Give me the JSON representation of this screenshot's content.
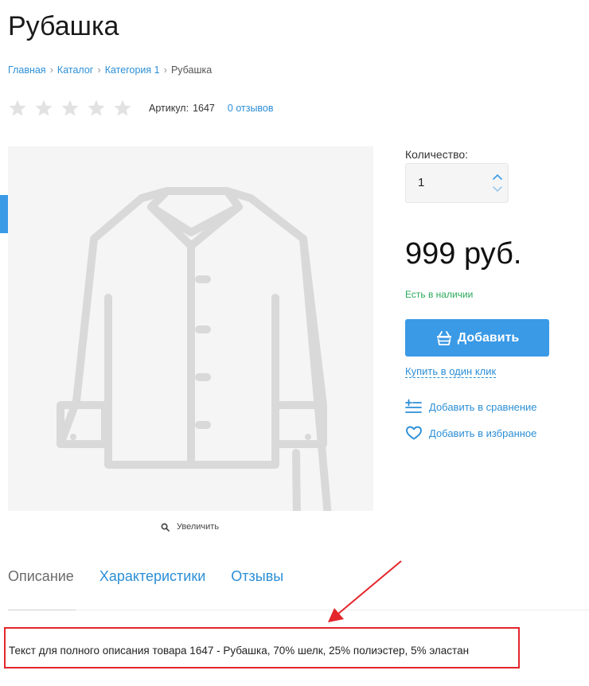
{
  "product": {
    "title": "Рубашка",
    "article_label": "Артикул:",
    "article_value": "1647",
    "reviews_link": "0 отзывов",
    "rating": 0,
    "rating_max": 5
  },
  "breadcrumb": {
    "items": [
      "Главная",
      "Каталог",
      "Категория 1"
    ],
    "current": "Рубашка"
  },
  "image": {
    "zoom_label": "Увеличить"
  },
  "buy": {
    "quantity_label": "Количество:",
    "quantity_value": "1",
    "price": "999 руб.",
    "stock": "Есть в наличии",
    "add_button": "Добавить",
    "one_click": "Купить в один клик",
    "compare": "Добавить в сравнение",
    "wishlist": "Добавить в избранное"
  },
  "tabs": [
    {
      "label": "Описание",
      "active": true
    },
    {
      "label": "Характеристики",
      "active": false
    },
    {
      "label": "Отзывы",
      "active": false
    }
  ],
  "description": {
    "text": "Текст для полного описания товара 1647 - Рубашка, 70% шелк, 25% полиэстер, 5% эластан"
  },
  "colors": {
    "accent": "#3a9ae6",
    "link": "#2c8fd6",
    "stock": "#2aa85a",
    "highlight": "#e3262b",
    "star_empty": "#e2e2e2"
  }
}
